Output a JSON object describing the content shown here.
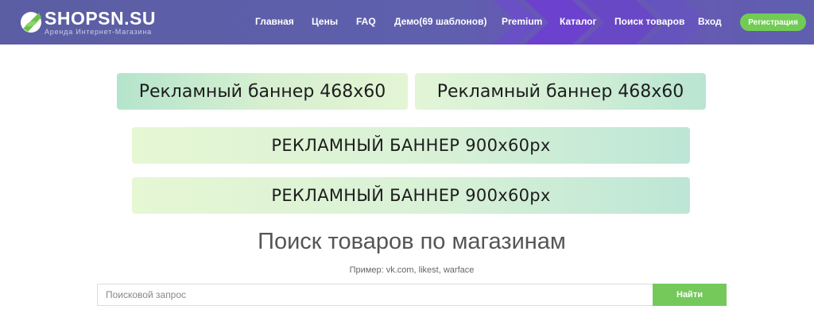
{
  "header": {
    "logo_name": "SHOPSN.SU",
    "logo_tagline": "Аренда Интернет-Магазина",
    "nav": [
      {
        "label": "Главная"
      },
      {
        "label": "Цены"
      },
      {
        "label": "FAQ"
      },
      {
        "label": "Демо(69 шаблонов)"
      },
      {
        "label": "Premium"
      },
      {
        "label": "Каталог"
      },
      {
        "label": "Поиск товаров"
      },
      {
        "label": "Вход"
      }
    ],
    "register_label": "Регистрация"
  },
  "banners": {
    "small": [
      "Рекламный баннер 468x60",
      "Рекламный баннер 468x60"
    ],
    "wide": [
      "РЕКЛАМНЫЙ БАННЕР 900x60px",
      "РЕКЛАМНЫЙ БАННЕР 900x60px"
    ]
  },
  "search": {
    "title": "Поиск товаров по магазинам",
    "example": "Пример: vk.com, likest, warface",
    "placeholder": "Поисковой запрос",
    "button_label": "Найти"
  },
  "colors": {
    "header_bg": "#5f5fae",
    "accent_green": "#72cc54",
    "chevron_purple": "#6b3fd0"
  }
}
